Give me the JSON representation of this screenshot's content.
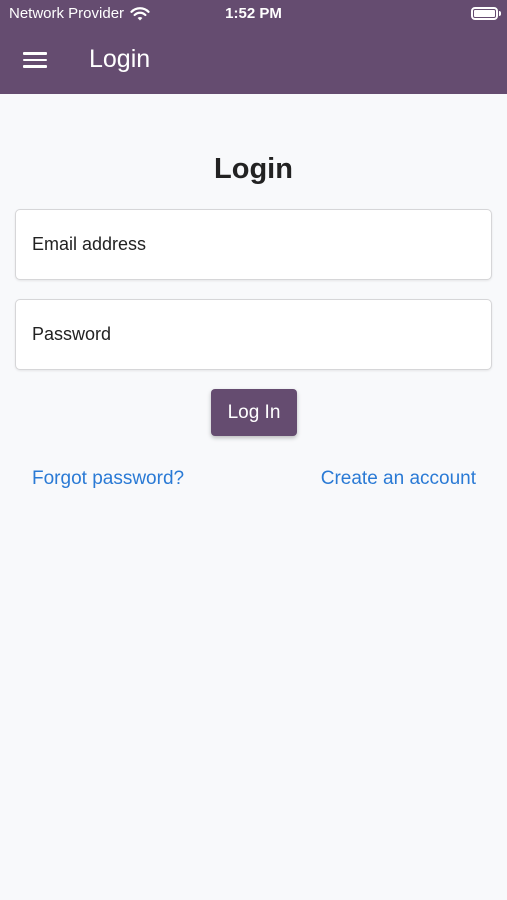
{
  "status_bar": {
    "carrier": "Network Provider",
    "time": "1:52 PM"
  },
  "header": {
    "title": "Login",
    "menu_icon": "hamburger-menu-icon"
  },
  "form": {
    "heading": "Login",
    "email_placeholder": "Email address",
    "password_placeholder": "Password",
    "submit_label": "Log In"
  },
  "links": {
    "forgot_password": "Forgot password?",
    "create_account": "Create an account"
  },
  "colors": {
    "brand": "#654c70",
    "link": "#2a7ad5",
    "background": "#f8f9fb"
  }
}
